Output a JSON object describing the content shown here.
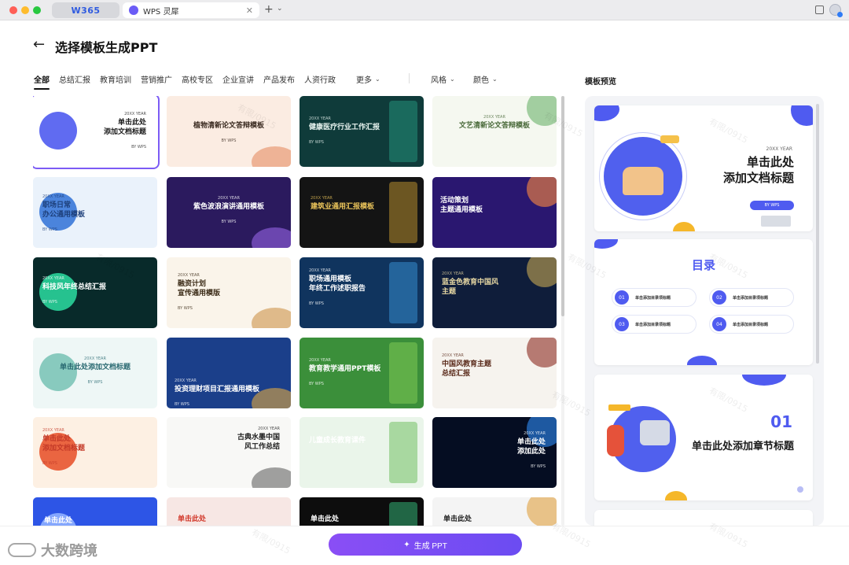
{
  "browser": {
    "brand_tab": "W365",
    "active_tab": "WPS 灵犀",
    "close_glyph": "✕",
    "new_tab_glyph": "+",
    "dropdown_glyph": "⌄"
  },
  "header": {
    "back_glyph": "←",
    "title": "选择模板生成PPT"
  },
  "filters": {
    "categories": [
      "全部",
      "总结汇报",
      "教育培训",
      "营销推广",
      "高校专区",
      "企业宣讲",
      "产品发布",
      "人资行政"
    ],
    "more": "更多",
    "style": "风格",
    "color": "颜色",
    "chevron": "⌄"
  },
  "preview": {
    "label": "模板预览",
    "slide1": {
      "year": "20XX YEAR",
      "title_line1": "单击此处",
      "title_line2": "添加文档标题",
      "button": "BY WPS"
    },
    "slide2": {
      "title": "目录",
      "items": [
        {
          "num": "01",
          "text": "单击添加目录项标题"
        },
        {
          "num": "02",
          "text": "单击添加目录项标题"
        },
        {
          "num": "03",
          "text": "单击添加目录项标题"
        },
        {
          "num": "04",
          "text": "单击添加目录项标题"
        }
      ]
    },
    "slide3": {
      "num": "01",
      "title": "单击此处添加章节标题"
    }
  },
  "templates": [
    {
      "line1": "单击此处",
      "line2": "添加文档标题",
      "year": "20XX YEAR",
      "by": "BY WPS",
      "bg": "#ffffff",
      "fg": "#1c1c1c",
      "accent": "#4f5bf0"
    },
    {
      "line1": "植物清新论文答辩模板",
      "line2": "",
      "year": "",
      "by": "BY WPS",
      "bg": "#fbece2",
      "fg": "#3a2a20",
      "accent": "#e38557"
    },
    {
      "line1": "健康医疗行业工作汇报",
      "line2": "",
      "year": "20XX YEAR",
      "by": "BY WPS",
      "bg": "#0f3b3a",
      "fg": "#e8f4f0",
      "accent": "#27a38a"
    },
    {
      "line1": "文艺清新论文答辩模板",
      "line2": "",
      "year": "20XX YEAR",
      "by": "",
      "bg": "#f5f8f0",
      "fg": "#4a6a3a",
      "accent": "#6bb36b"
    },
    {
      "line1": "职场日常",
      "line2": "办公通用模板",
      "year": "20XX YEAR",
      "by": "BY WPS",
      "bg": "#eaf2fb",
      "fg": "#1d3f7a",
      "accent": "#3a78d8"
    },
    {
      "line1": "紫色波浪演讲通用模板",
      "line2": "",
      "year": "20XX YEAR",
      "by": "BY WPS",
      "bg": "#2b1a5e",
      "fg": "#ffffff",
      "accent": "#a16cf2"
    },
    {
      "line1": "建筑业通用汇报模板",
      "line2": "",
      "year": "20XX YEAR",
      "by": "",
      "bg": "#141414",
      "fg": "#e9c35a",
      "accent": "#d8a632"
    },
    {
      "line1": "活动策划",
      "line2": "主题通用模板",
      "year": "",
      "by": "",
      "bg": "#2a1770",
      "fg": "#ffffff",
      "accent": "#ff8a3d"
    },
    {
      "line1": "科技风年终总结汇报",
      "line2": "",
      "year": "20XX YEAR",
      "by": "BY WPS",
      "bg": "#082a2a",
      "fg": "#ffffff",
      "accent": "#2ad39a"
    },
    {
      "line1": "融资计划",
      "line2": "宣传通用模版",
      "year": "20XX YEAR",
      "by": "BY WPS",
      "bg": "#faf4ea",
      "fg": "#3c2c18",
      "accent": "#c98a3a"
    },
    {
      "line1": "职场通用模板",
      "line2": "年终工作述职报告",
      "year": "20XX YEAR",
      "by": "BY WPS",
      "bg": "#10345e",
      "fg": "#ffffff",
      "accent": "#3fa0e6"
    },
    {
      "line1": "蓝金色教育中国风",
      "line2": "主题",
      "year": "20XX YEAR",
      "by": "",
      "bg": "#0f1d3a",
      "fg": "#e6d7a3",
      "accent": "#c7a954"
    },
    {
      "line1": "单击此处添加文档标题",
      "line2": "",
      "year": "20XX YEAR",
      "by": "BY WPS",
      "bg": "#eef7f6",
      "fg": "#2a6a72",
      "accent": "#7cc4b8"
    },
    {
      "line1": "投资理财项目汇报通用模板",
      "line2": "",
      "year": "20XX YEAR",
      "by": "BY WPS",
      "bg": "#1b3f8a",
      "fg": "#ffffff",
      "accent": "#f2b23a"
    },
    {
      "line1": "教育教学通用PPT模板",
      "line2": "",
      "year": "20XX YEAR",
      "by": "BY WPS",
      "bg": "#3b8f3a",
      "fg": "#ffffff",
      "accent": "#8fd65a"
    },
    {
      "line1": "中国风教育主题",
      "line2": "总结汇报",
      "year": "20XX YEAR",
      "by": "",
      "bg": "#f6f3ee",
      "fg": "#5a2a1a",
      "accent": "#8c2a20"
    },
    {
      "line1": "单击此处",
      "line2": "添加文档标题",
      "year": "20XX YEAR",
      "by": "BY WPS",
      "bg": "#fdf0e3",
      "fg": "#c43a28",
      "accent": "#e8552f"
    },
    {
      "line1": "古典水墨中国",
      "line2": "风工作总结",
      "year": "20XX YEAR",
      "by": "",
      "bg": "#f8f8f6",
      "fg": "#222222",
      "accent": "#555555"
    },
    {
      "line1": "儿童成长教育课件",
      "line2": "",
      "year": "",
      "by": "",
      "bg": "#eaf5ea",
      "fg": "#ffffff",
      "accent": "#58b548"
    },
    {
      "line1": "单击此处",
      "line2": "添加此处",
      "year": "20XX YEAR",
      "by": "BY WPS",
      "bg": "#050d22",
      "fg": "#ffffff",
      "accent": "#2f8cf6"
    },
    {
      "line1": "单击此处",
      "line2": "",
      "year": "",
      "by": "",
      "bg": "#2d55e6",
      "fg": "#ffffff",
      "accent": "#8fb0ff"
    },
    {
      "line1": "单击此处",
      "line2": "",
      "year": "",
      "by": "",
      "bg": "#f7e7e4",
      "fg": "#d23a2c",
      "accent": "#e85a4a"
    },
    {
      "line1": "单击此处",
      "line2": "",
      "year": "",
      "by": "",
      "bg": "#0d0d0d",
      "fg": "#ffffff",
      "accent": "#3ad38a"
    },
    {
      "line1": "单击此处",
      "line2": "",
      "year": "",
      "by": "",
      "bg": "#f4f4f4",
      "fg": "#222222",
      "accent": "#e0a040"
    }
  ],
  "actions": {
    "generate": "生成 PPT",
    "spark": "✦"
  },
  "watermark": {
    "brand": "大数跨境",
    "tag": "有限/0915"
  }
}
